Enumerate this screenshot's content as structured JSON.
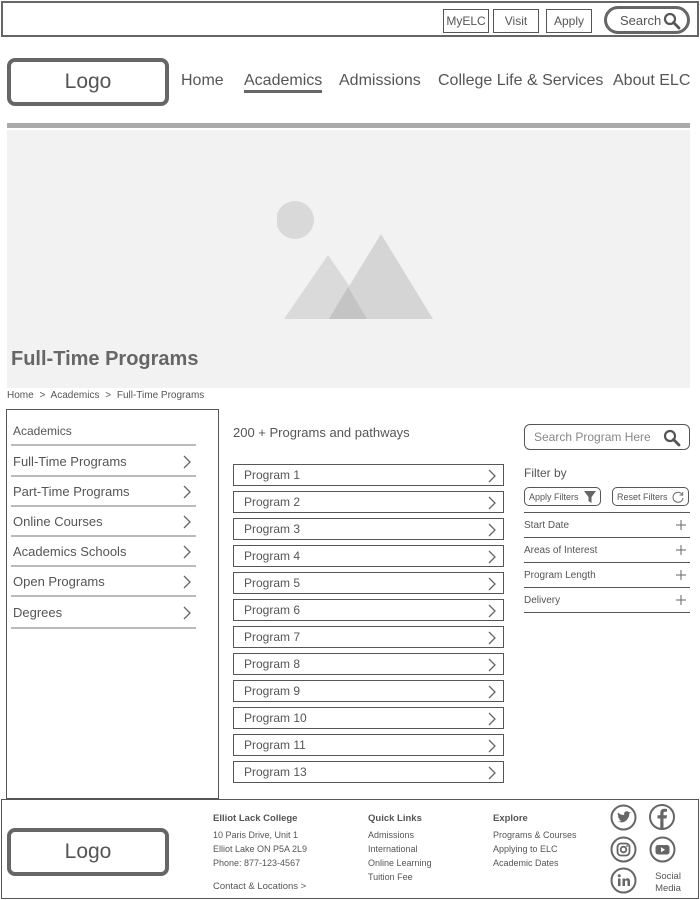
{
  "utility": {
    "myelc": "MyELC",
    "visit": "Visit",
    "apply": "Apply",
    "search": "Search"
  },
  "header": {
    "logo": "Logo",
    "nav": [
      {
        "label": "Home"
      },
      {
        "label": "Academics",
        "active": true
      },
      {
        "label": "Admissions"
      },
      {
        "label": "College Life & Services"
      },
      {
        "label": "About ELC"
      }
    ]
  },
  "hero": {
    "title": "Full-Time Programs"
  },
  "breadcrumb": [
    "Home",
    ">",
    "Academics",
    ">",
    "Full-Time Programs"
  ],
  "sidebar": {
    "heading": "Academics",
    "items": [
      {
        "label": "Full-Time Programs"
      },
      {
        "label": "Part-Time Programs"
      },
      {
        "label": "Online Courses"
      },
      {
        "label": "Academics Schools"
      },
      {
        "label": "Open Programs"
      },
      {
        "label": "Degrees"
      }
    ]
  },
  "programs": {
    "count_text": "200 + Programs and pathways",
    "items": [
      "Program 1",
      "Program 2",
      "Program 3",
      "Program 4",
      "Program 5",
      "Program 6",
      "Program 7",
      "Program 8",
      "Program 9",
      "Program 10",
      "Program 11",
      "Program 13"
    ]
  },
  "filters": {
    "search_placeholder": "Search Program Here",
    "label": "Filter by",
    "apply": "Apply Filters",
    "reset": "Reset Filters",
    "facets": [
      "Start Date",
      "Areas of Interest",
      "Program Length",
      "Delivery"
    ]
  },
  "footer": {
    "logo": "Logo",
    "college": {
      "heading": "Elliot Lack College",
      "lines": [
        "10 Paris Drive, Unit 1",
        "Elliot Lake ON P5A 2L9",
        "Phone: 877-123-4567"
      ]
    },
    "contact_link": "Contact & Locations >",
    "quick_links": {
      "heading": "Quick Links",
      "items": [
        "Admissions",
        "International",
        "Online Learning",
        "Tuition Fee"
      ]
    },
    "explore": {
      "heading": "Explore",
      "items": [
        "Programs & Courses",
        "Applying to ELC",
        "Academic Dates"
      ]
    },
    "social_label": "Social Media",
    "social_icons": [
      "twitter-icon",
      "facebook-icon",
      "instagram-icon",
      "youtube-icon",
      "linkedin-icon"
    ]
  },
  "colors": {
    "stroke": "#666666",
    "placeholder_bg": "#f2f2f2",
    "rule": "#aaaaaa"
  }
}
